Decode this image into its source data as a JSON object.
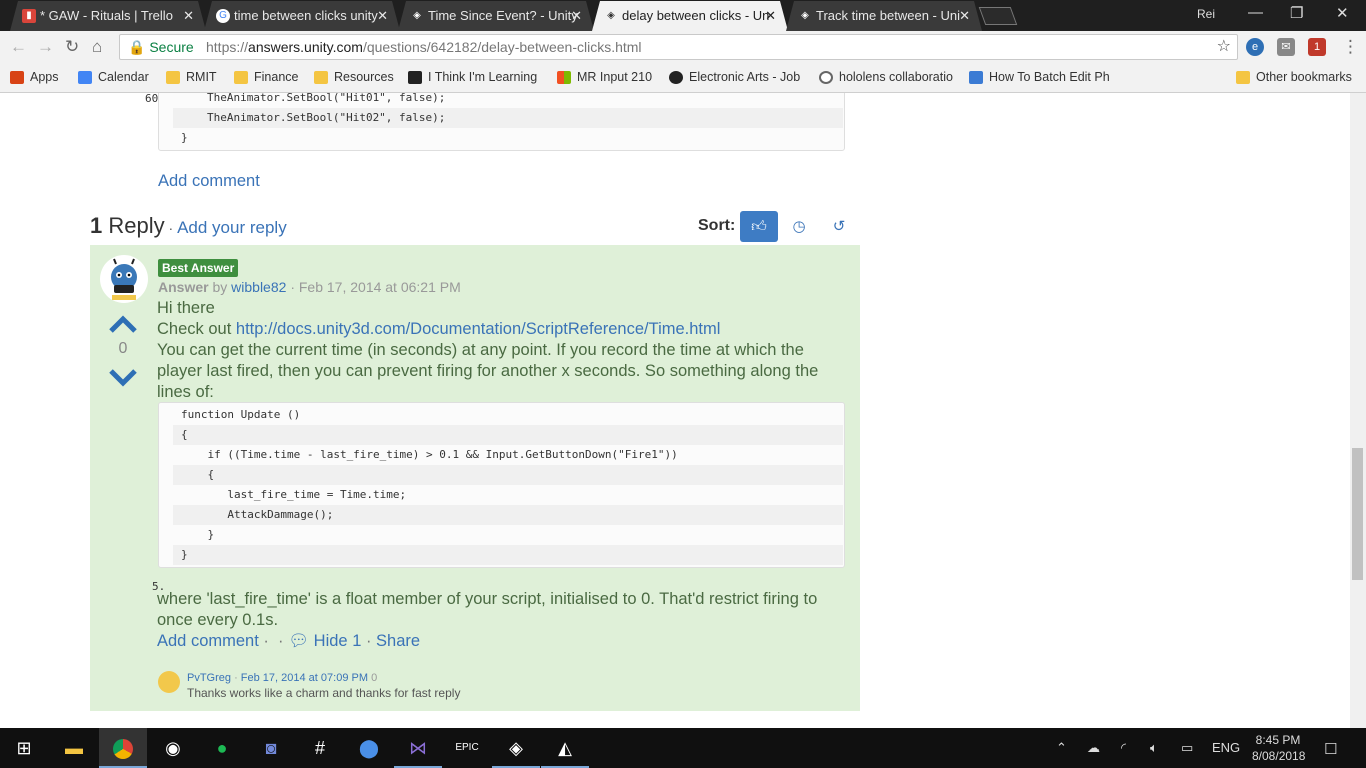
{
  "browser": {
    "tabs": [
      {
        "title": "* GAW - Rituals | Trello",
        "favicon": "trello-icon",
        "favicon_color": "#d9453b",
        "active": false
      },
      {
        "title": "time between clicks unity",
        "favicon": "google-icon",
        "favicon_color": "#ffffff",
        "active": false
      },
      {
        "title": "Time Since Event? - Unity",
        "favicon": "unity-icon",
        "favicon_color": "#ffffff",
        "active": false
      },
      {
        "title": "delay between clicks - Un",
        "favicon": "unity-icon",
        "favicon_color": "#ffffff",
        "active": true
      },
      {
        "title": "Track time between - Uni",
        "favicon": "unity-icon",
        "favicon_color": "#ffffff",
        "active": false
      }
    ],
    "user": "Rei",
    "secure_label": "Secure",
    "url_scheme": "https://",
    "url_host": "answers.unity.com",
    "url_path": "/questions/642182/delay-between-clicks.html",
    "bookmarks": [
      {
        "label": "Apps",
        "icon": "apps-grid-icon",
        "color": "#d84315"
      },
      {
        "label": "Calendar",
        "icon": "calendar-icon",
        "color": "#4285f4"
      },
      {
        "label": "RMIT",
        "icon": "folder-icon",
        "color": "#f4c542"
      },
      {
        "label": "Finance",
        "icon": "folder-icon",
        "color": "#f4c542"
      },
      {
        "label": "Resources",
        "icon": "folder-icon",
        "color": "#f4c542"
      },
      {
        "label": "I Think I'm Learning",
        "icon": "trello-icon",
        "color": "#222222"
      },
      {
        "label": "MR Input 210",
        "icon": "microsoft-icon",
        "color": "#f25022"
      },
      {
        "label": "Electronic Arts - Job",
        "icon": "ea-icon",
        "color": "#222222"
      },
      {
        "label": "hololens collaboratio",
        "icon": "google-icon",
        "color": "#ffffff"
      },
      {
        "label": "How To Batch Edit Ph",
        "icon": "puzzle-icon",
        "color": "#3b7bd4"
      }
    ],
    "other_bookmarks": "Other bookmarks"
  },
  "page": {
    "top_code": {
      "line_number": "60.",
      "lines": [
        "TheAnimator.SetBool(\"Hit01\", false);",
        "TheAnimator.SetBool(\"Hit02\", false);",
        "}"
      ]
    },
    "add_comment_label": "Add comment",
    "reply_count": "1",
    "reply_word": "Reply",
    "add_reply_label": "Add your reply",
    "sort_label": "Sort:",
    "answer": {
      "badge": "Best Answer",
      "kind": "Answer",
      "by": "by",
      "author": "wibble82",
      "date": "Feb 17, 2014 at 06:21 PM",
      "votes": "0",
      "greeting": "Hi there",
      "checkout_prefix": "Check out",
      "checkout_link": "http://docs.unity3d.com/Documentation/ScriptReference/Time.html",
      "body1": "You can get the current time (in seconds) at any point. If you record the time at which the player last fired, then you can prevent firing for another x seconds. So something along the lines of:",
      "code_lines": [
        "function Update ()",
        "{",
        "    if ((Time.time - last_fire_time) > 0.1 && Input.GetButtonDown(\"Fire1\"))",
        "    {",
        "       last_fire_time = Time.time;",
        "       AttackDammage();",
        "    }",
        "}"
      ],
      "code_marker": "5.",
      "body2": "where 'last_fire_time' is a float member of your script, initialised to 0. That'd restrict firing to once every 0.1s.",
      "actions": {
        "comment": "Add comment",
        "hide": "Hide 1",
        "share": "Share"
      }
    },
    "comment": {
      "author": "PvTGreg",
      "date": "Feb 17, 2014 at 07:09 PM",
      "votes": "0",
      "text": "Thanks works like a charm and thanks for fast reply"
    }
  },
  "taskbar": {
    "apps": [
      "start-icon",
      "file-explorer-icon",
      "chrome-icon",
      "media-icon",
      "spotify-icon",
      "discord-icon",
      "slack-icon",
      "maps-icon",
      "visual-studio-icon",
      "epic-games-icon",
      "unity-icon",
      "unity-hub-icon"
    ],
    "lang": "ENG",
    "time": "8:45 PM",
    "date": "8/08/2018"
  }
}
